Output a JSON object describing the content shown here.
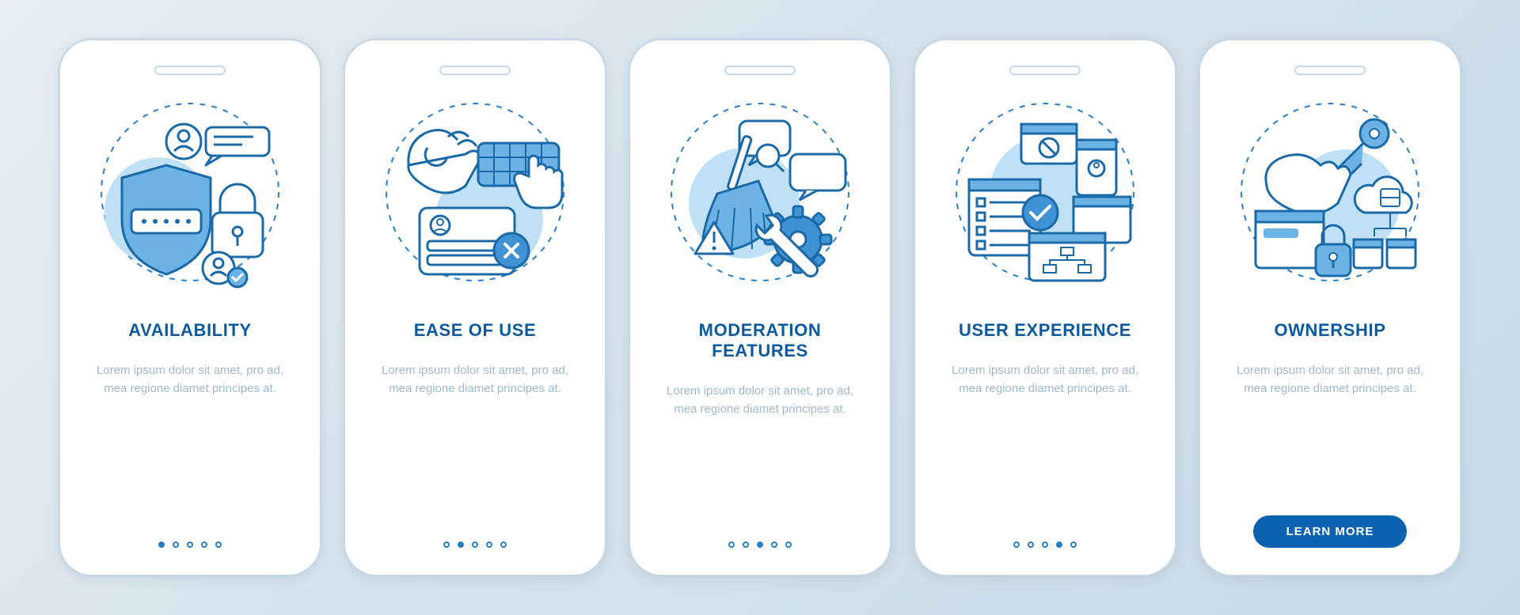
{
  "colors": {
    "primary": "#0b63b0",
    "stroke": "#1b6aa8",
    "fill_light": "#6db2e4",
    "fill_mid": "#3f93d4",
    "dashed": "#2a7ec5"
  },
  "screens": [
    {
      "id": "availability",
      "title": "AVAILABILITY",
      "description": "Lorem ipsum dolor sit amet, pro ad, mea regione diamet principes at.",
      "active_dot": 0,
      "icon_semantic": "shield-lock-user-icon"
    },
    {
      "id": "ease-of-use",
      "title": "EASE OF USE",
      "description": "Lorem ipsum dolor sit amet, pro ad, mea regione diamet principes at.",
      "active_dot": 1,
      "icon_semantic": "hand-ok-keyboard-icon"
    },
    {
      "id": "moderation-features",
      "title": "MODERATION FEATURES",
      "description": "Lorem ipsum dolor sit amet, pro ad, mea regione diamet principes at.",
      "active_dot": 2,
      "icon_semantic": "broom-gear-chat-icon"
    },
    {
      "id": "user-experience",
      "title": "USER EXPERIENCE",
      "description": "Lorem ipsum dolor sit amet, pro ad, mea regione diamet principes at.",
      "active_dot": 3,
      "icon_semantic": "windows-check-flow-icon"
    },
    {
      "id": "ownership",
      "title": "OWNERSHIP",
      "description": "Lorem ipsum dolor sit amet, pro ad, mea regione diamet principes at.",
      "active_dot": 4,
      "icon_semantic": "key-hand-cloud-lock-icon",
      "cta_label": "LEARN MORE"
    }
  ],
  "dot_count": 5
}
